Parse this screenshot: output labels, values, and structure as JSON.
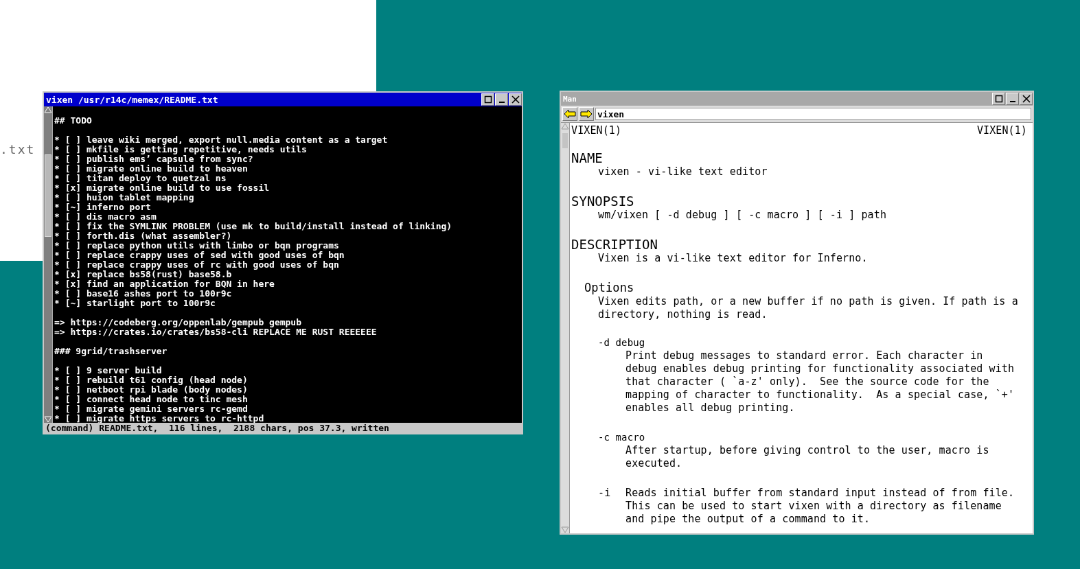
{
  "background_window": {
    "text": ".txt"
  },
  "editor": {
    "title": "vixen /usr/r14c/memex/README.txt",
    "sections": [
      [
        "## TODO"
      ],
      [
        "* [ ] leave wiki merged, export null.media content as a target",
        "* [ ] mkfile is getting repetitive, needs utils",
        "* [ ] publish ems’ capsule from sync?",
        "* [ ] migrate online build to heaven",
        "* [ ] titan deploy to quetzal ns",
        "* [x] migrate online build to use fossil",
        "* [ ] huion tablet mapping",
        "* [~] inferno port",
        "* [ ] dis macro asm",
        "* [ ] fix the SYMLINK PROBLEM (use mk to build/install instead of linking)",
        "* [ ] forth.dis (what assembler?)",
        "* [ ] replace python utils with limbo or bqn programs",
        "* [ ] replace crappy uses of sed with good uses of bqn",
        "* [ ] replace crappy uses of rc with good uses of bqn",
        "* [x] replace bs58(rust) base58.b",
        "* [x] find an application for BQN in here",
        "* [ ] base16 ashes port to 100r9c",
        "* [~] starlight port to 100r9c"
      ],
      [
        "=> https://codeberg.org/oppenlab/gempub gempub",
        "=> https://crates.io/crates/bs58-cli REPLACE ME RUST REEEEEE"
      ],
      [
        "### 9grid/trashserver"
      ],
      [
        "* [ ] 9 server build",
        "* [ ] rebuild t61 config (head node)",
        "* [ ] netboot rpi blade (body nodes)",
        "* [ ] connect head node to tinc mesh",
        "* [ ] migrate gemini servers rc-gemd",
        "* [ ] migrate https servers to rc-httpd"
      ]
    ],
    "status": "(command) README.txt,  116 lines,  2188 chars, pos 37.3, written"
  },
  "man": {
    "title": "Man",
    "address": "vixen",
    "header_left": "VIXEN(1)",
    "header_right": "VIXEN(1)",
    "blocks": [
      {
        "kind": "heading",
        "text": "NAME"
      },
      {
        "kind": "para",
        "lines": [
          "vixen - vi-like text editor"
        ]
      },
      {
        "kind": "heading",
        "text": "SYNOPSIS"
      },
      {
        "kind": "para",
        "lines": [
          "wm/vixen [ -d debug ] [ -c macro ] [ -i ] path"
        ]
      },
      {
        "kind": "heading",
        "text": "DESCRIPTION"
      },
      {
        "kind": "para",
        "lines": [
          "Vixen is a vi-like text editor for Inferno."
        ]
      },
      {
        "kind": "subheading",
        "text": "Options"
      },
      {
        "kind": "para",
        "lines": [
          "Vixen edits path, or a new buffer if no path is given. If path is a",
          "directory, nothing is read."
        ]
      },
      {
        "kind": "option",
        "flag": "-d debug",
        "lines": [
          "Print debug messages to standard error. Each character in",
          "debug enables debug printing for functionality associated with",
          "that character ( `a-z' only).  See the source code for the",
          "mapping of character to functionality.  As a special case, `+'",
          "enables all debug printing."
        ]
      },
      {
        "kind": "option",
        "flag": "-c macro",
        "lines": [
          "After startup, before giving control to the user, macro is",
          "executed."
        ]
      },
      {
        "kind": "option_inline",
        "flag": "-i",
        "lines": [
          "Reads initial buffer from standard input instead of from file.",
          "This can be used to start vixen with a directory as filename",
          "and pipe the output of a command to it."
        ]
      }
    ]
  }
}
